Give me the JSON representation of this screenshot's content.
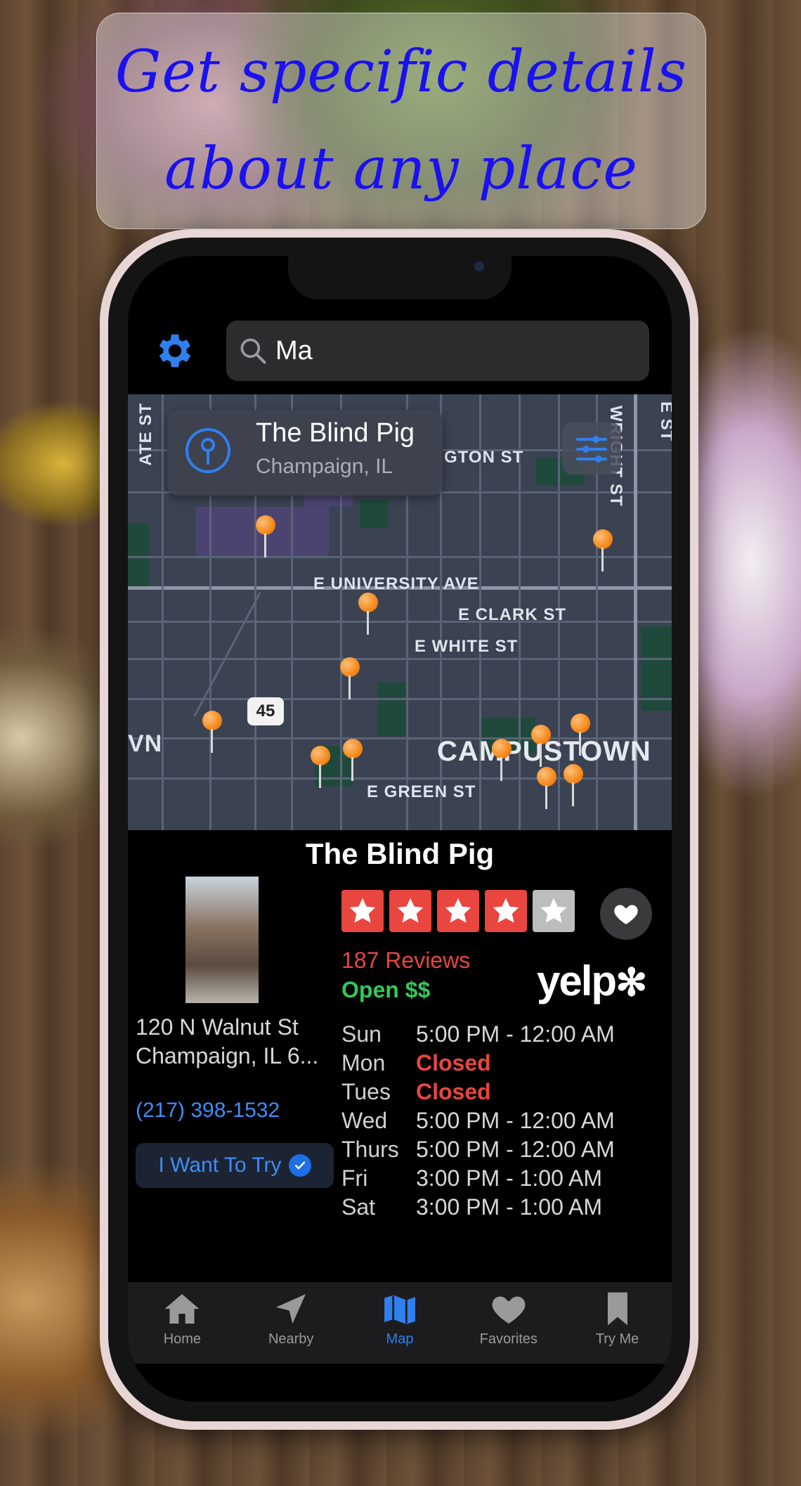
{
  "banner": {
    "text_line1": "Get specific details",
    "text_line2": "about any place"
  },
  "search": {
    "query": "Ma",
    "icon": "magnifier-icon"
  },
  "settings": {
    "icon": "gear-icon"
  },
  "map": {
    "callout": {
      "title": "The Blind Pig",
      "subtitle": "Champaign, IL"
    },
    "streets": [
      "E UNIVERSITY AVE",
      "E CLARK ST",
      "E WHITE ST",
      "E GREEN ST",
      "GTON ST",
      "WRIGHT ST",
      "ATE ST",
      "VN",
      "E ST"
    ],
    "area": "CAMPUSTOWN",
    "route_shield": "45"
  },
  "place": {
    "name": "The Blind Pig",
    "rating": 4,
    "rating_max": 5,
    "reviews": "187 Reviews",
    "status": "Open $$",
    "brand": "yelp",
    "address_line1": "120 N Walnut St",
    "address_line2": "Champaign, IL 6...",
    "phone": "(217) 398-1532",
    "try_button": "I Want To Try",
    "hours": [
      {
        "day": "Sun",
        "time": "5:00 PM - 12:00 AM",
        "closed": false
      },
      {
        "day": "Mon",
        "time": "Closed",
        "closed": true
      },
      {
        "day": "Tues",
        "time": "Closed",
        "closed": true
      },
      {
        "day": "Wed",
        "time": "5:00 PM - 12:00 AM",
        "closed": false
      },
      {
        "day": "Thurs",
        "time": "5:00 PM - 12:00 AM",
        "closed": false
      },
      {
        "day": "Fri",
        "time": "3:00 PM - 1:00 AM",
        "closed": false
      },
      {
        "day": "Sat",
        "time": "3:00 PM - 1:00 AM",
        "closed": false
      }
    ]
  },
  "tabs": [
    {
      "label": "Home",
      "icon": "house-icon"
    },
    {
      "label": "Nearby",
      "icon": "location-arrow-icon"
    },
    {
      "label": "Map",
      "icon": "map-icon",
      "active": true
    },
    {
      "label": "Favorites",
      "icon": "heart-icon"
    },
    {
      "label": "Try Me",
      "icon": "bookmark-icon"
    }
  ],
  "colors": {
    "accent": "#2f80ed",
    "star": "#e8463f",
    "open": "#34c759",
    "banner_text": "#1a10f0"
  }
}
